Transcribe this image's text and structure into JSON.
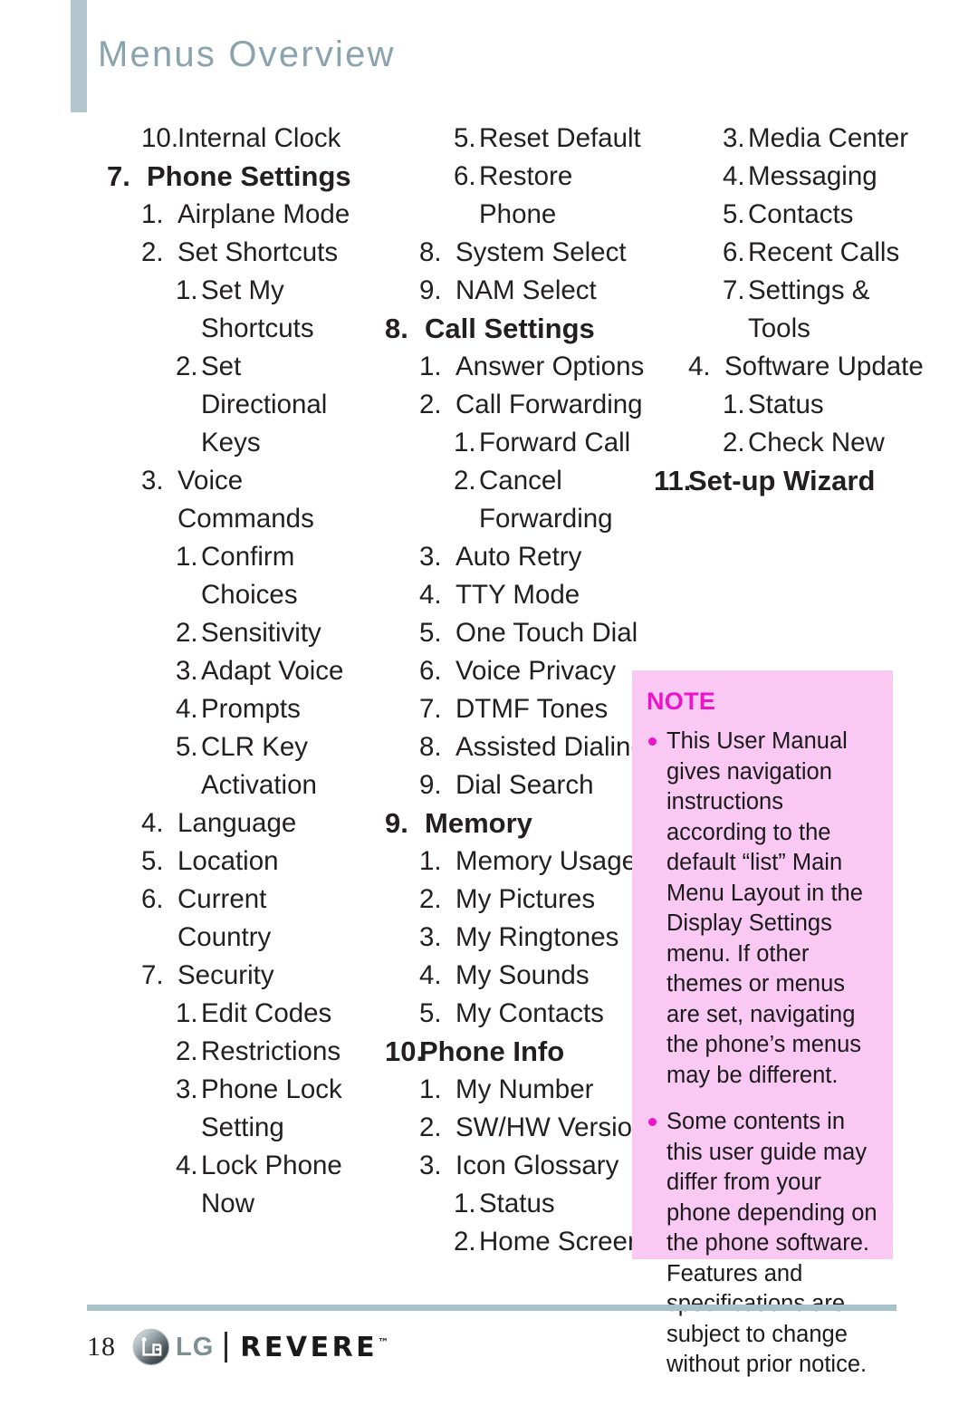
{
  "header": {
    "title": "Menus Overview",
    "accent_color": "#b4c6cd",
    "title_color": "#8ba3ad"
  },
  "columns": [
    {
      "id": "column-1",
      "lines": [
        {
          "level": "lvl2",
          "num": "10.",
          "text": "Internal Clock",
          "tight": true
        },
        {
          "level": "lvl1",
          "num": "7.",
          "text": "Phone Settings"
        },
        {
          "level": "lvl2",
          "num": "1.",
          "text": "Airplane Mode"
        },
        {
          "level": "lvl2",
          "num": "2.",
          "text": "Set Shortcuts"
        },
        {
          "level": "lvl3",
          "num": "1.",
          "text": "Set My"
        },
        {
          "level": "cont3",
          "num": "",
          "text": "Shortcuts"
        },
        {
          "level": "lvl3",
          "num": "2.",
          "text": "Set"
        },
        {
          "level": "cont3",
          "num": "",
          "text": "Directional"
        },
        {
          "level": "cont3",
          "num": "",
          "text": "Keys"
        },
        {
          "level": "lvl2",
          "num": "3.",
          "text": "Voice"
        },
        {
          "level": "cont2",
          "num": "",
          "text": "Commands"
        },
        {
          "level": "lvl3",
          "num": "1.",
          "text": "Confirm"
        },
        {
          "level": "cont3",
          "num": "",
          "text": "Choices"
        },
        {
          "level": "lvl3",
          "num": "2.",
          "text": "Sensitivity"
        },
        {
          "level": "lvl3",
          "num": "3.",
          "text": "Adapt Voice"
        },
        {
          "level": "lvl3",
          "num": "4.",
          "text": "Prompts"
        },
        {
          "level": "lvl3",
          "num": "5.",
          "text": "CLR Key"
        },
        {
          "level": "cont3",
          "num": "",
          "text": "Activation"
        },
        {
          "level": "lvl2",
          "num": "4.",
          "text": "Language"
        },
        {
          "level": "lvl2",
          "num": "5.",
          "text": "Location"
        },
        {
          "level": "lvl2",
          "num": "6.",
          "text": "Current"
        },
        {
          "level": "cont2",
          "num": "",
          "text": "Country"
        },
        {
          "level": "lvl2",
          "num": "7.",
          "text": "Security"
        },
        {
          "level": "lvl3",
          "num": "1.",
          "text": "Edit Codes"
        },
        {
          "level": "lvl3",
          "num": "2.",
          "text": "Restrictions"
        },
        {
          "level": "lvl3",
          "num": "3.",
          "text": "Phone Lock"
        },
        {
          "level": "cont3",
          "num": "",
          "text": "Setting"
        },
        {
          "level": "lvl3",
          "num": "4.",
          "text": "Lock Phone"
        },
        {
          "level": "cont3",
          "num": "",
          "text": "Now"
        }
      ]
    },
    {
      "id": "column-2",
      "lines": [
        {
          "level": "lvl3",
          "num": "5.",
          "text": "Reset Default"
        },
        {
          "level": "lvl3",
          "num": "6.",
          "text": "Restore"
        },
        {
          "level": "cont3",
          "num": "",
          "text": "Phone"
        },
        {
          "level": "lvl2",
          "num": "8.",
          "text": "System Select"
        },
        {
          "level": "lvl2",
          "num": "9.",
          "text": "NAM Select"
        },
        {
          "level": "lvl1",
          "num": "8.",
          "text": "Call Settings"
        },
        {
          "level": "lvl2",
          "num": "1.",
          "text": "Answer Options"
        },
        {
          "level": "lvl2",
          "num": "2.",
          "text": "Call Forwarding"
        },
        {
          "level": "lvl3",
          "num": "1.",
          "text": "Forward Call"
        },
        {
          "level": "lvl3",
          "num": "2.",
          "text": "Cancel"
        },
        {
          "level": "cont3",
          "num": "",
          "text": "Forwarding"
        },
        {
          "level": "lvl2",
          "num": "3.",
          "text": "Auto Retry"
        },
        {
          "level": "lvl2",
          "num": "4.",
          "text": "TTY Mode"
        },
        {
          "level": "lvl2",
          "num": "5.",
          "text": "One Touch Dial"
        },
        {
          "level": "lvl2",
          "num": "6.",
          "text": "Voice Privacy"
        },
        {
          "level": "lvl2",
          "num": "7.",
          "text": "DTMF Tones"
        },
        {
          "level": "lvl2",
          "num": "8.",
          "text": "Assisted Dialing"
        },
        {
          "level": "lvl2",
          "num": "9.",
          "text": "Dial Search"
        },
        {
          "level": "lvl1",
          "num": "9.",
          "text": "Memory"
        },
        {
          "level": "lvl2",
          "num": "1.",
          "text": "Memory Usage"
        },
        {
          "level": "lvl2",
          "num": "2.",
          "text": "My Pictures"
        },
        {
          "level": "lvl2",
          "num": "3.",
          "text": "My Ringtones"
        },
        {
          "level": "lvl2",
          "num": "4.",
          "text": "My Sounds"
        },
        {
          "level": "lvl2",
          "num": "5.",
          "text": "My Contacts"
        },
        {
          "level": "lvl1",
          "num": "10.",
          "text": "Phone Info",
          "tight": true
        },
        {
          "level": "lvl2",
          "num": "1.",
          "text": "My Number"
        },
        {
          "level": "lvl2",
          "num": "2.",
          "text": "SW/HW Version"
        },
        {
          "level": "lvl2",
          "num": "3.",
          "text": "Icon Glossary"
        },
        {
          "level": "lvl3",
          "num": "1.",
          "text": "Status"
        },
        {
          "level": "lvl3",
          "num": "2.",
          "text": "Home Screen"
        }
      ]
    },
    {
      "id": "column-3",
      "lines": [
        {
          "level": "lvl3",
          "num": "3.",
          "text": "Media Center"
        },
        {
          "level": "lvl3",
          "num": "4.",
          "text": "Messaging"
        },
        {
          "level": "lvl3",
          "num": "5.",
          "text": "Contacts"
        },
        {
          "level": "lvl3",
          "num": "6.",
          "text": "Recent Calls"
        },
        {
          "level": "lvl3",
          "num": "7.",
          "text": "Settings &"
        },
        {
          "level": "cont3",
          "num": "",
          "text": "Tools"
        },
        {
          "level": "lvl2",
          "num": "4.",
          "text": "Software Update"
        },
        {
          "level": "lvl3",
          "num": "1.",
          "text": "Status"
        },
        {
          "level": "lvl3",
          "num": "2.",
          "text": "Check New"
        },
        {
          "level": "lvl1",
          "num": "11.",
          "text": "Set-up Wizard",
          "tight": true
        }
      ]
    }
  ],
  "note": {
    "title": "NOTE",
    "background_color": "#f9c9f4",
    "accent_color": "#ec13c8",
    "bullets": [
      "This User Manual gives navigation instructions according to the default “list” Main Menu Layout in the Display Settings menu. If other themes or menus are set, navigating the phone’s menus may be different.",
      "Some contents in this user guide may differ from your phone depending on the phone software. Features and specifications are subject to change without prior notice."
    ]
  },
  "footer": {
    "page_number": "18",
    "lg_wordmark": "LG",
    "product_wordmark": "REVERE",
    "trademark": "™"
  }
}
